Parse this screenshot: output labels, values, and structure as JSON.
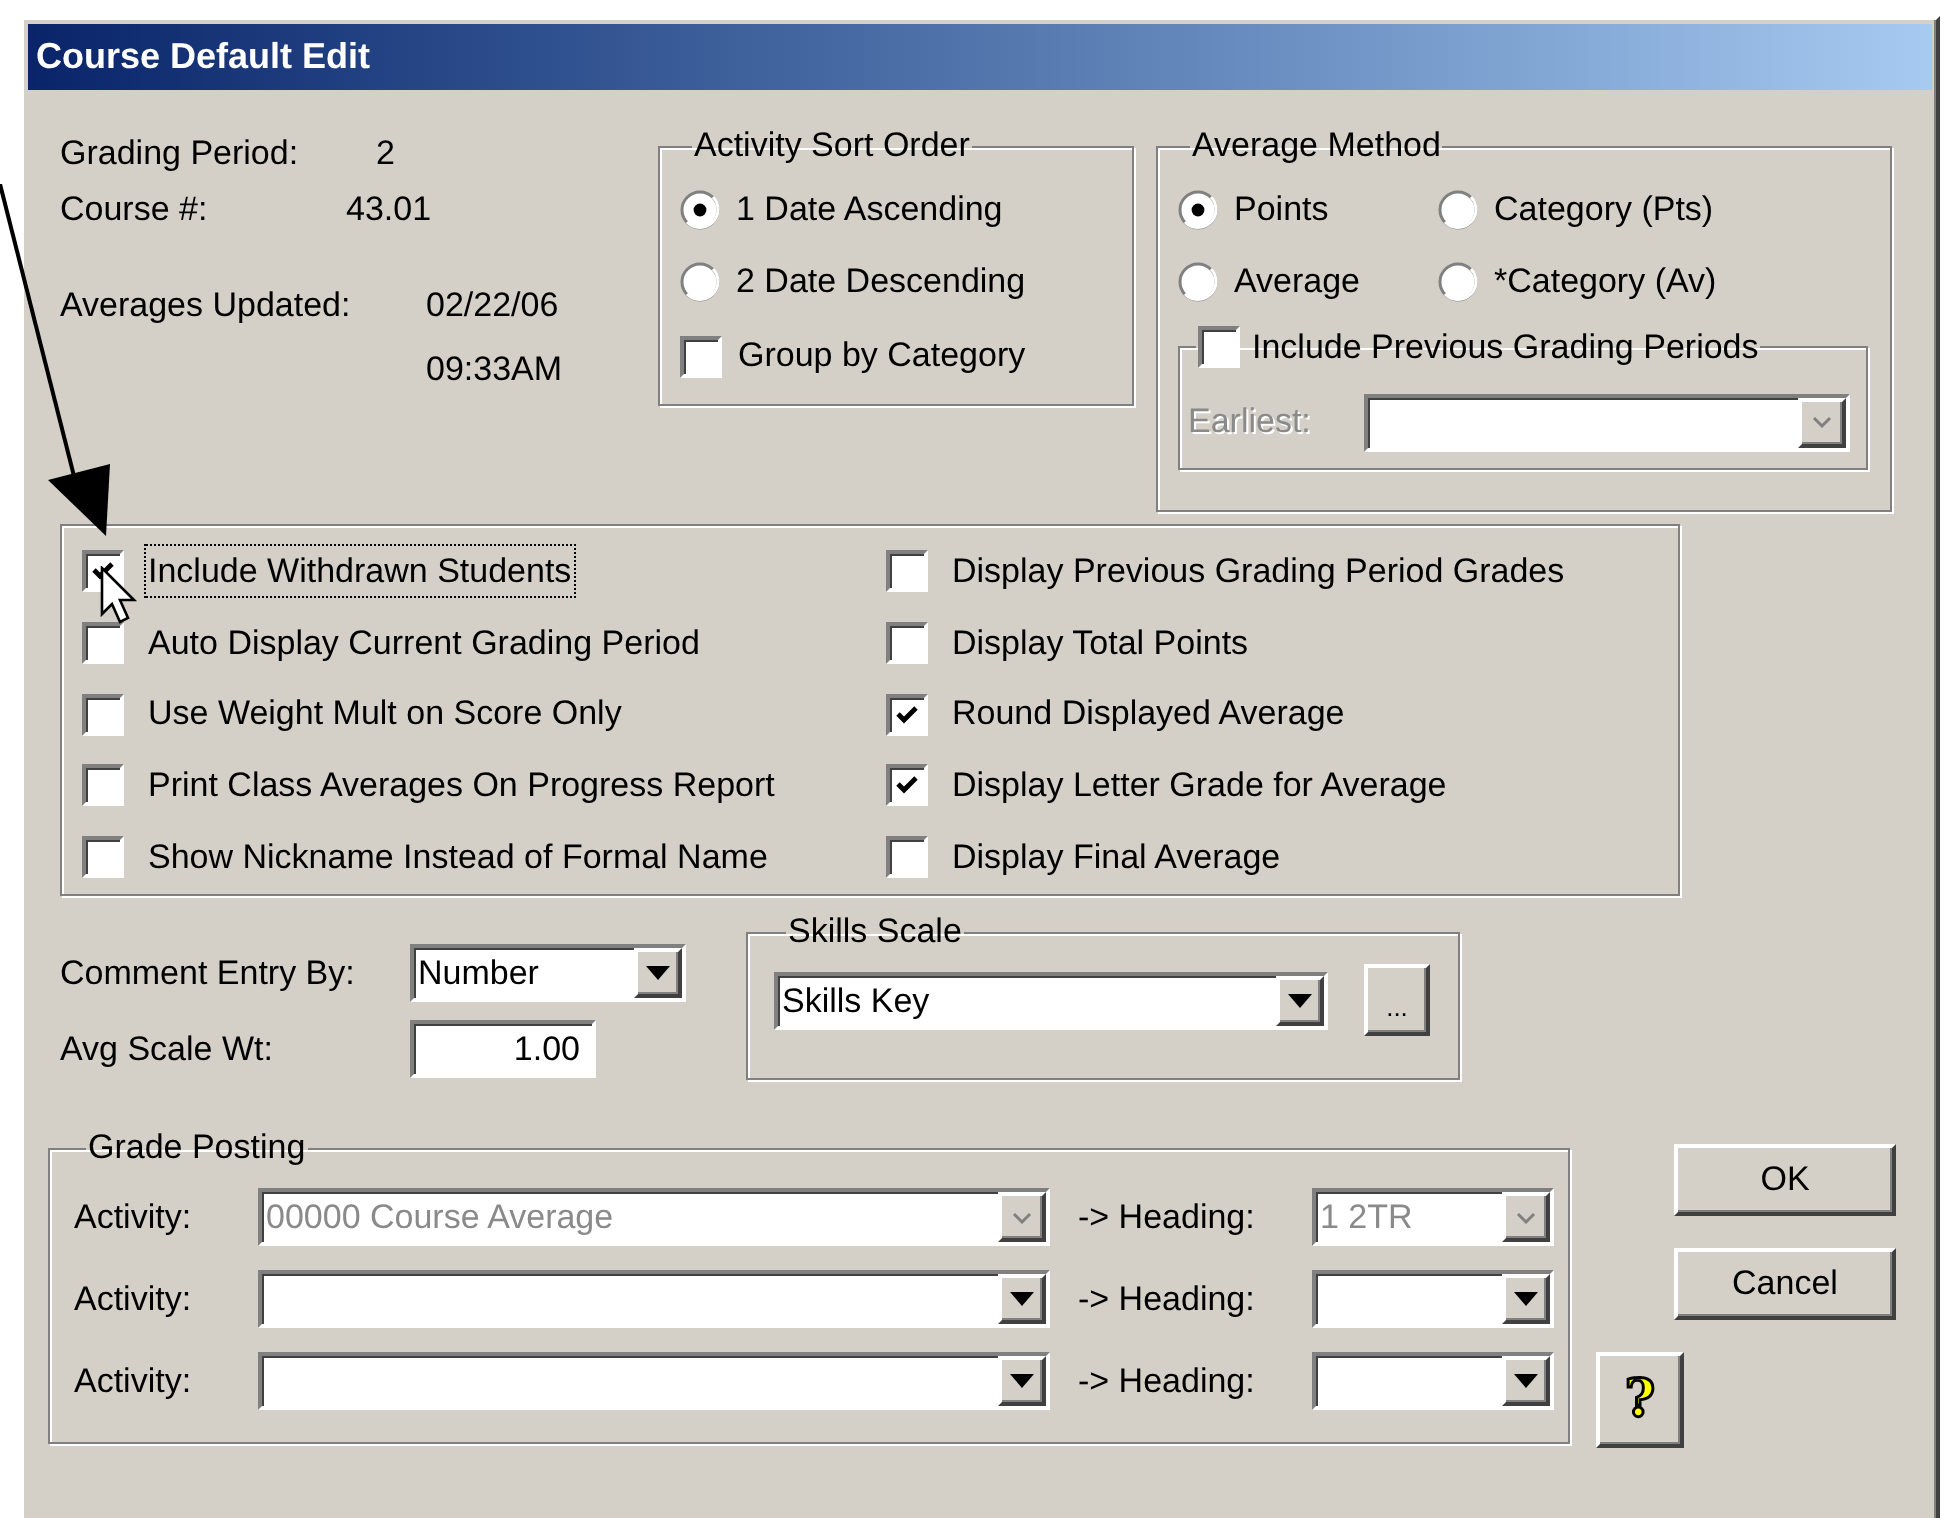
{
  "window": {
    "title": "Course Default Edit"
  },
  "info": {
    "grading_period": {
      "label": "Grading Period:",
      "value": "2"
    },
    "course": {
      "label": "Course #:",
      "value": "43.01"
    },
    "averages_updated": {
      "label": "Averages Updated:",
      "date": "02/22/06",
      "time": "09:33AM"
    }
  },
  "activity_sort_order": {
    "title": "Activity Sort Order",
    "options": [
      {
        "label": "1 Date Ascending",
        "selected": true
      },
      {
        "label": "2 Date Descending",
        "selected": false
      }
    ],
    "group_by_category": {
      "label": "Group by Category",
      "checked": false
    }
  },
  "average_method": {
    "title": "Average Method",
    "options": [
      {
        "label": "Points",
        "selected": true
      },
      {
        "label": "Category (Pts)",
        "selected": false
      },
      {
        "label": "Average",
        "selected": false
      },
      {
        "label": "*Category (Av)",
        "selected": false
      }
    ],
    "include_previous": {
      "label": "Include Previous Grading Periods",
      "checked": false
    },
    "earliest": {
      "label": "Earliest:",
      "disabled": true
    }
  },
  "options": [
    {
      "label": "Include Withdrawn Students",
      "checked": true,
      "focused": true
    },
    {
      "label": "Auto Display Current Grading Period",
      "checked": false,
      "focused": false
    },
    {
      "label": "Use Weight Mult on Score Only",
      "checked": false,
      "focused": false
    },
    {
      "label": "Print Class Averages On Progress Report",
      "checked": false,
      "focused": false
    },
    {
      "label": "Show Nickname Instead of Formal Name",
      "checked": false,
      "focused": false
    },
    {
      "label": "Display Previous Grading Period Grades",
      "checked": false,
      "focused": false
    },
    {
      "label": "Display Total Points",
      "checked": false,
      "focused": false
    },
    {
      "label": "Round Displayed Average",
      "checked": true,
      "focused": false
    },
    {
      "label": "Display Letter Grade for Average",
      "checked": true,
      "focused": false
    },
    {
      "label": "Display Final Average",
      "checked": false,
      "focused": false
    }
  ],
  "comment_entry": {
    "label": "Comment Entry By:",
    "value": "Number"
  },
  "avg_scale_wt": {
    "label": "Avg Scale Wt:",
    "value": "1.00"
  },
  "skills_scale": {
    "title": "Skills Scale",
    "value": "Skills Key",
    "browse": "..."
  },
  "grade_posting": {
    "title": "Grade Posting",
    "rows": [
      {
        "activity_label": "Activity:",
        "activity": "00000 Course Average",
        "heading_label": "-> Heading:",
        "heading": "1 2TR",
        "disabled": true
      },
      {
        "activity_label": "Activity:",
        "heading_label": "-> Heading:",
        "disabled": false
      },
      {
        "activity_label": "Activity:",
        "heading_label": "-> Heading:",
        "disabled": false
      }
    ]
  },
  "buttons": [
    {
      "label": "OK"
    },
    {
      "label": "Cancel"
    }
  ],
  "help_button": "?"
}
